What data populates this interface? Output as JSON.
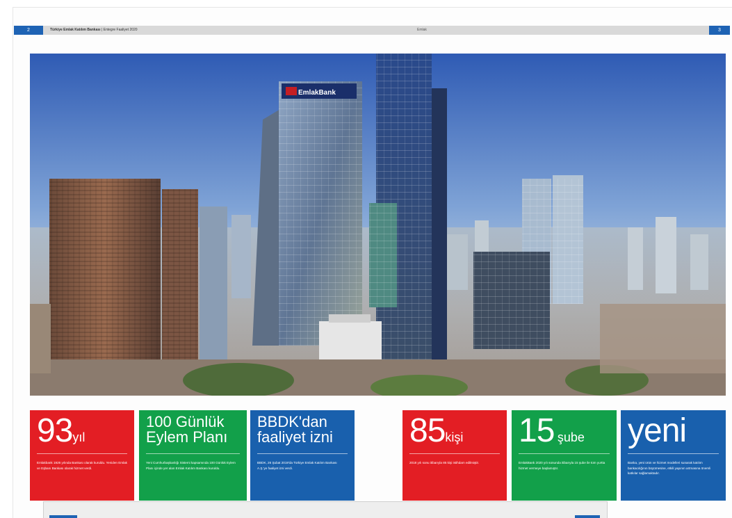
{
  "header": {
    "page_left": "2",
    "page_right": "3",
    "title": "Türkiye Emlak Katılım Bankası",
    "subtitle": "Entegre Faaliyet 2020",
    "center_text": "Emlak"
  },
  "photo": {
    "sign_text": "EmlakBank"
  },
  "stats": [
    {
      "value": "93",
      "unit": "yıl",
      "color": "#e31e24",
      "description": "Emlakbank 1926 yılında Bankası olarak kuruldu. Yeniden Emlak ve Eşbanı Bankası olarak hizmet verdi."
    },
    {
      "value": "100 Günlük Eylem Planı",
      "unit": "",
      "color": "#12a04a",
      "description": "Yeni Cumhurbaşkanlığı Sistemi kapsamında 100 Günlük Eylem Planı içinde yer alan Emlak Katılım Bankası kuruldu."
    },
    {
      "value": "BBDK'dan faaliyet izni",
      "unit": "",
      "color": "#1960ad",
      "description": "BBDK, 26 Şubat 2019'da Türkiye Emlak Katılım Bankası A.Ş.'ye faaliyet izni verdi."
    },
    {
      "value": "85",
      "unit": "kişi",
      "color": "#e31e24",
      "description": "2018 yılı sonu itibarıyla 85 kişi istihdam edilmiştir."
    },
    {
      "value": "15",
      "unit": "şube",
      "color": "#12a04a",
      "description": "EmlakBank 2020 yılı sonunda itibarıyla 15 şube ile tüm yurtta hizmet vermeye başlamıştır."
    },
    {
      "value": "yeni",
      "unit": "",
      "color": "#1960ad",
      "description": "Banka, yeni ürün ve hizmet modelleri sunarak katılım bankacılığının büyümesine, etkili yapının artmasına önemli katkılar sağlamaktadır."
    }
  ]
}
